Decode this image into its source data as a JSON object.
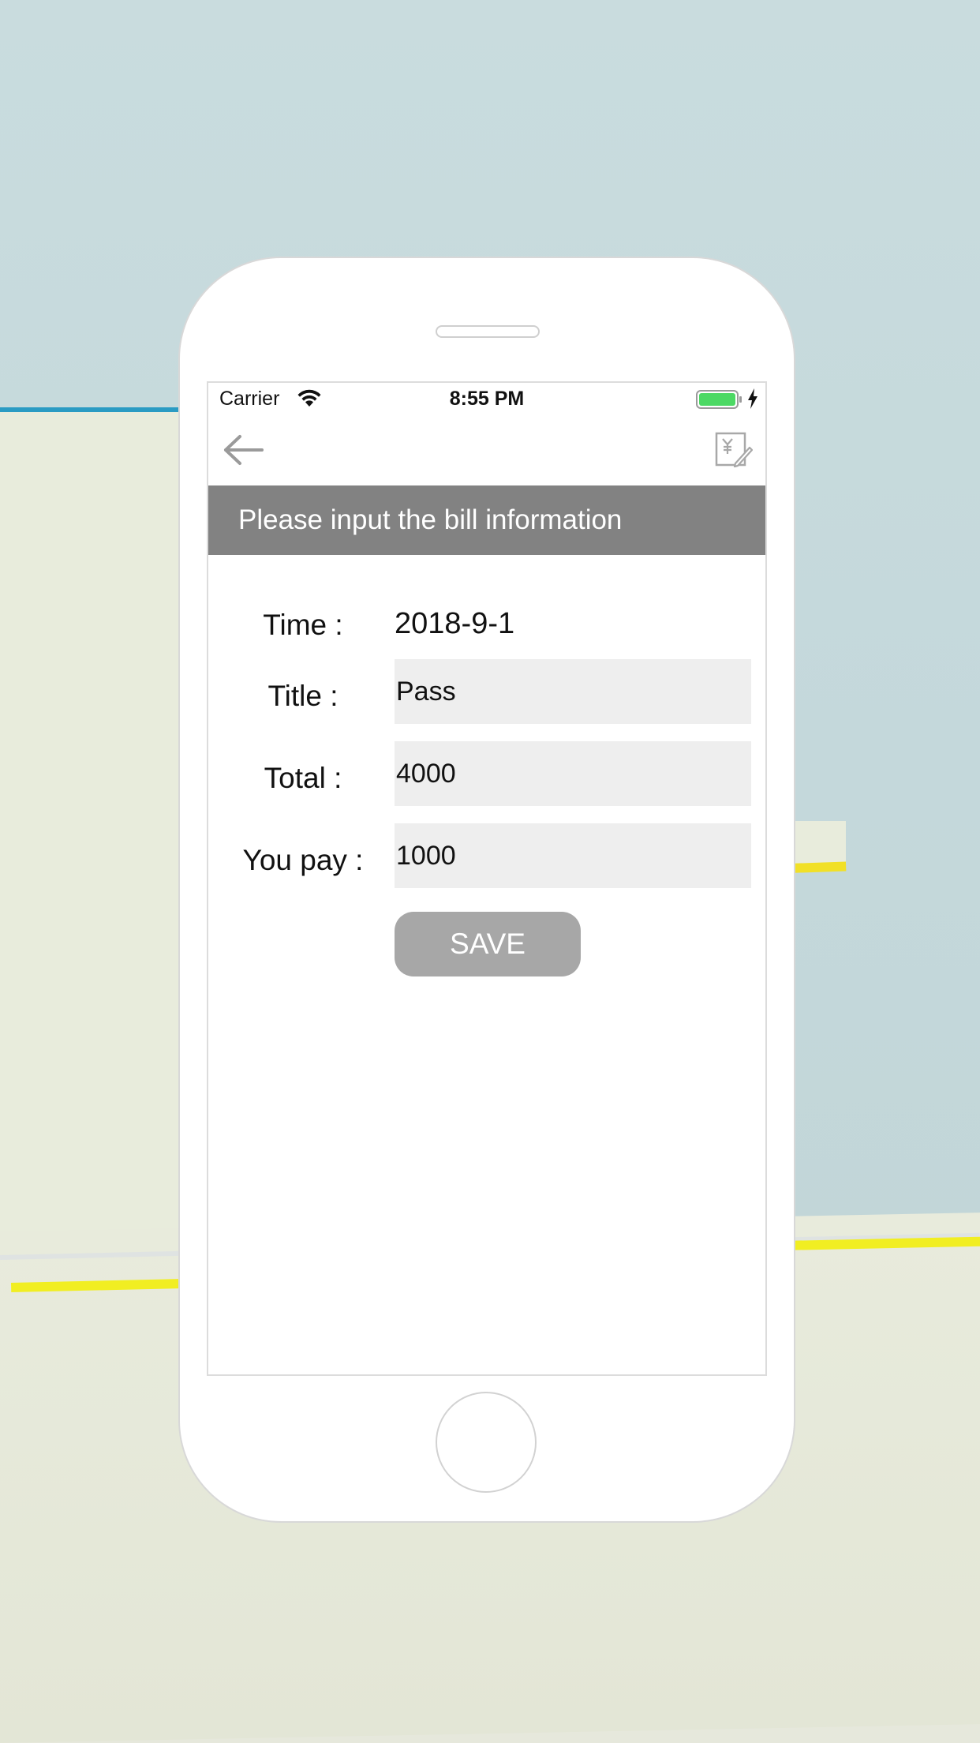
{
  "status_bar": {
    "carrier": "Carrier",
    "time": "8:55 PM"
  },
  "nav": {
    "back_icon": "arrow-left-icon",
    "action_icon": "yen-edit-icon"
  },
  "banner": {
    "title": "Please input the bill information"
  },
  "form": {
    "time_label": "Time :",
    "time_value": "2018-9-1",
    "title_label": "Title :",
    "title_value": "Pass",
    "total_label": "Total :",
    "total_value": "4000",
    "pay_label": "You pay :",
    "pay_value": "1000",
    "save_label": "SAVE"
  },
  "colors": {
    "banner_bg": "#828282",
    "field_bg": "#eeeeee",
    "button_bg": "#a7a7a7",
    "battery": "#4cd964"
  }
}
